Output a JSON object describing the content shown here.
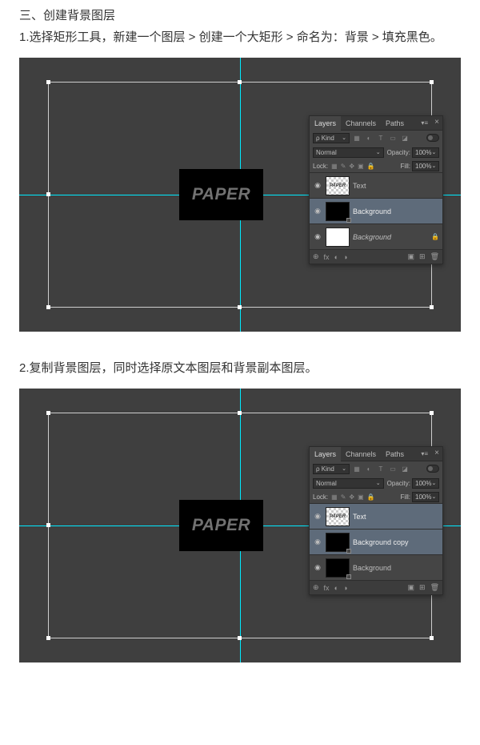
{
  "section": {
    "title": "三、创建背景图层"
  },
  "step1": {
    "text": "1.选择矩形工具，新建一个图层 > 创建一个大矩形 > 命名为：背景 > 填充黑色。"
  },
  "step2": {
    "text": "2.复制背景图层，同时选择原文本图层和背景副本图层。"
  },
  "paper_label": "PAPER",
  "panel1": {
    "tabs": {
      "layers": "Layers",
      "channels": "Channels",
      "paths": "Paths"
    },
    "kind_label": "Kind",
    "blend_mode": "Normal",
    "opacity_label": "Opacity:",
    "opacity_value": "100%",
    "lock_label": "Lock:",
    "fill_label": "Fill:",
    "fill_value": "100%",
    "layers": [
      {
        "name": "Text",
        "selected": false,
        "thumb": "paper",
        "italic": false
      },
      {
        "name": "Background",
        "selected": true,
        "thumb": "black",
        "italic": false,
        "corner": true
      },
      {
        "name": "Background",
        "selected": false,
        "thumb": "white",
        "italic": true,
        "lock": true
      }
    ]
  },
  "panel2": {
    "tabs": {
      "layers": "Layers",
      "channels": "Channels",
      "paths": "Paths"
    },
    "kind_label": "Kind",
    "blend_mode": "Normal",
    "opacity_label": "Opacity:",
    "opacity_value": "100%",
    "lock_label": "Lock:",
    "fill_label": "Fill:",
    "fill_value": "100%",
    "layers": [
      {
        "name": "Text",
        "selected": true,
        "thumb": "paper",
        "italic": false
      },
      {
        "name": "Background copy",
        "selected": true,
        "thumb": "black",
        "italic": false,
        "corner": true
      },
      {
        "name": "Background",
        "selected": false,
        "thumb": "black",
        "italic": false,
        "corner": true
      }
    ]
  },
  "icons": {
    "close": "×",
    "menu": "▾≡",
    "dropdown": "⌄",
    "eye": "◉",
    "lock": "🔒",
    "link": "⊕",
    "fx": "fx",
    "mask": "◐",
    "folder": "▣",
    "new": "⊞",
    "trash": "🗑"
  }
}
